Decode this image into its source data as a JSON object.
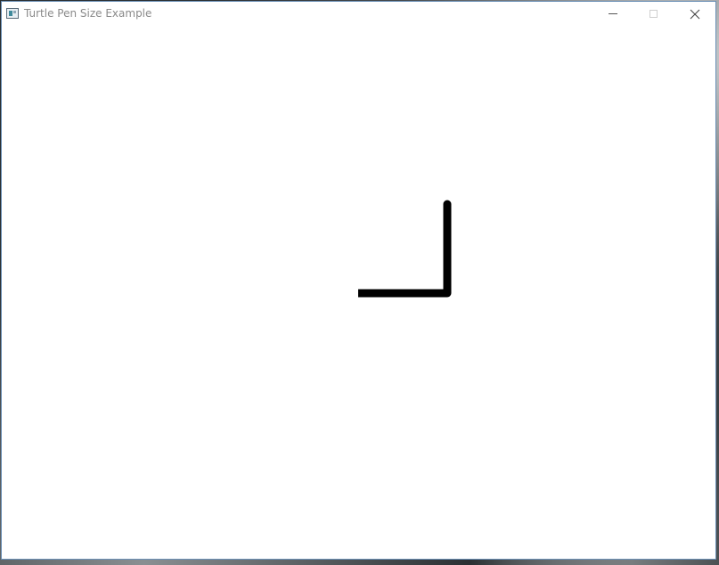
{
  "window": {
    "title": "Turtle Pen Size Example",
    "background_color": "#ffffff"
  },
  "title_bar": {
    "icon": "app-window-icon",
    "minimize_icon": "minimize-icon",
    "maximize_icon": "maximize-icon",
    "close_icon": "close-icon"
  },
  "drawing": {
    "pen_color": "#000000",
    "description_of_strokes": []
  }
}
